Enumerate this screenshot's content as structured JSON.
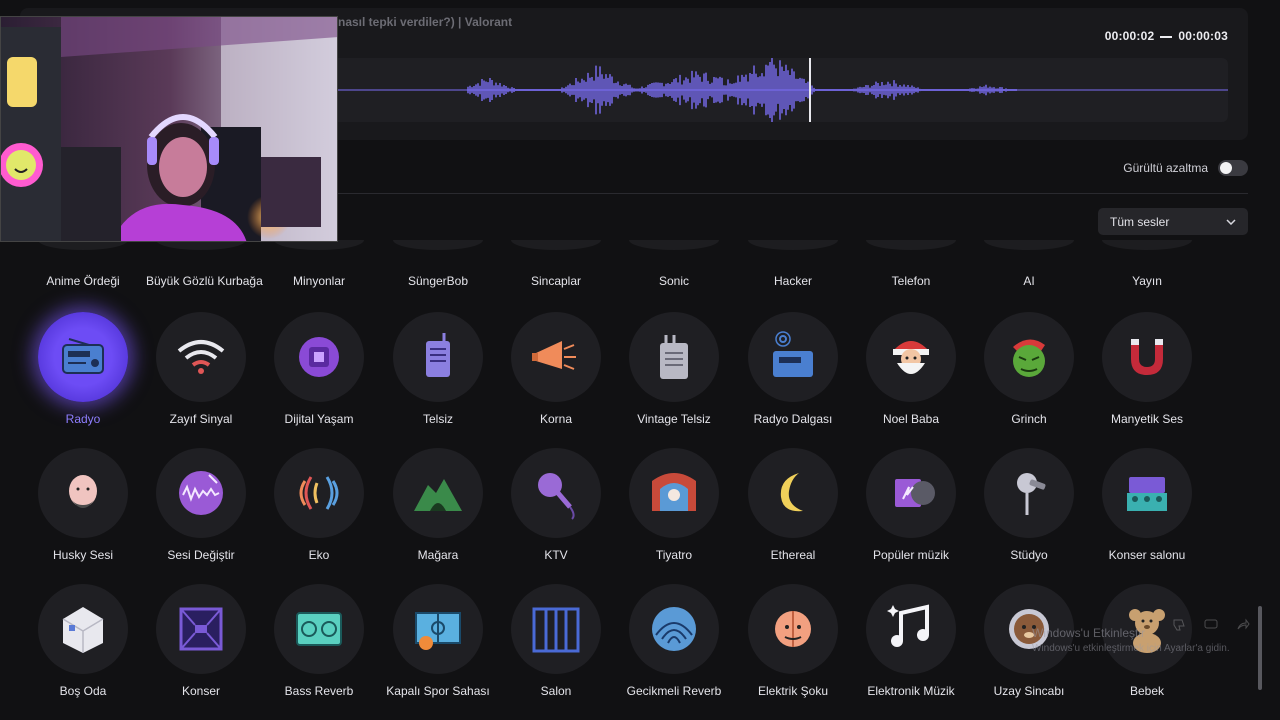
{
  "audio": {
    "clip_title": "nasıl tepki verdiler?) | Valorant",
    "time_start": "00:00:02",
    "time_end": "00:00:03",
    "accent": "#7b6ef6"
  },
  "noise_reduction": {
    "label": "Gürültü azaltma",
    "on": false
  },
  "filter": {
    "selected": "Tüm sesler"
  },
  "top_row_labels": [
    "Anime Ördeği",
    "Büyük Gözlü Kurbağa",
    "Minyonlar",
    "SüngerBob",
    "Sincaplar",
    "Sonic",
    "Hacker",
    "Telefon",
    "AI",
    "Yayın"
  ],
  "rows": [
    [
      {
        "label": "Radyo",
        "icon": "radio-icon",
        "active": true
      },
      {
        "label": "Zayıf Sinyal",
        "icon": "wifi-weak-icon"
      },
      {
        "label": "Dijital Yaşam",
        "icon": "chip-icon"
      },
      {
        "label": "Telsiz",
        "icon": "walkie-talkie-icon"
      },
      {
        "label": "Korna",
        "icon": "megaphone-icon"
      },
      {
        "label": "Vintage Telsiz",
        "icon": "vintage-walkie-icon"
      },
      {
        "label": "Radyo Dalgası",
        "icon": "radio-wave-icon"
      },
      {
        "label": "Noel Baba",
        "icon": "santa-icon"
      },
      {
        "label": "Grinch",
        "icon": "grinch-icon"
      },
      {
        "label": "Manyetik Ses",
        "icon": "magnet-icon"
      }
    ],
    [
      {
        "label": "Husky Sesi",
        "icon": "bald-man-icon"
      },
      {
        "label": "Sesi Değiştir",
        "icon": "magic-wave-icon"
      },
      {
        "label": "Eko",
        "icon": "echo-icon"
      },
      {
        "label": "Mağara",
        "icon": "cave-icon"
      },
      {
        "label": "KTV",
        "icon": "microphone-icon"
      },
      {
        "label": "Tiyatro",
        "icon": "theater-icon"
      },
      {
        "label": "Ethereal",
        "icon": "moon-icon"
      },
      {
        "label": "Popüler müzik",
        "icon": "music-player-icon"
      },
      {
        "label": "Stüdyo",
        "icon": "studio-mic-icon"
      },
      {
        "label": "Konser salonu",
        "icon": "concert-hall-icon"
      }
    ],
    [
      {
        "label": "Boş Oda",
        "icon": "empty-room-icon"
      },
      {
        "label": "Konser",
        "icon": "concert-stage-icon"
      },
      {
        "label": "Bass Reverb",
        "icon": "speaker-icon"
      },
      {
        "label": "Kapalı Spor Sahası",
        "icon": "basketball-court-icon"
      },
      {
        "label": "Salon",
        "icon": "hall-icon"
      },
      {
        "label": "Gecikmeli Reverb",
        "icon": "delay-reverb-icon"
      },
      {
        "label": "Elektrik Şoku",
        "icon": "shock-face-icon"
      },
      {
        "label": "Elektronik Müzik",
        "icon": "music-note-icon"
      },
      {
        "label": "Uzay Sincabı",
        "icon": "astronaut-icon"
      },
      {
        "label": "Bebek",
        "icon": "teddy-bear-icon"
      }
    ]
  ],
  "watermark": {
    "title": "Windows'u Etkinleştir",
    "subtitle": "Windows'u etkinleştirmek için Ayarlar'a gidin."
  }
}
